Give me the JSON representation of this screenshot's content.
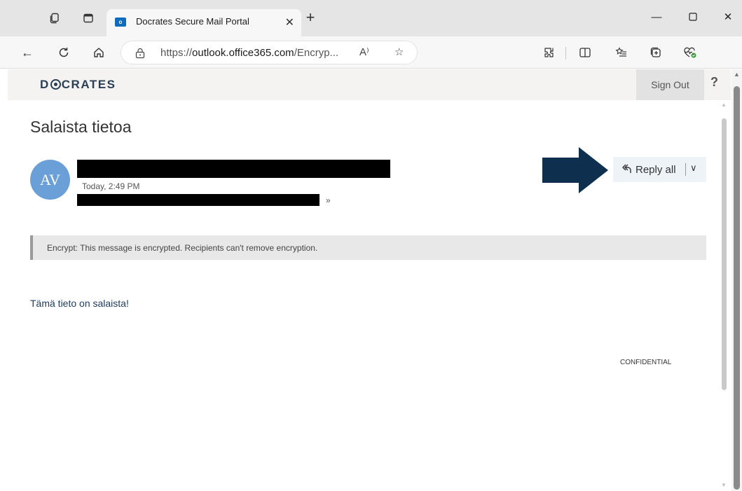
{
  "browser": {
    "tab_title": "Docrates Secure Mail Portal",
    "url_prefix": "https://",
    "url_host": "outlook.office365.com",
    "url_rest": "/Encryp...",
    "read_aloud_label": "A⁾",
    "accent_color": "#0f6cbd"
  },
  "page": {
    "logo_left": "D",
    "logo_right": "CRATES",
    "sign_out_label": "Sign Out",
    "help_label": "?"
  },
  "message": {
    "subject": "Salaista tietoa",
    "avatar_initials": "AV",
    "avatar_color": "#6a9fd8",
    "datetime": "Today, 2:49 PM",
    "reply_all_label": "Reply all",
    "encryption_notice": "Encrypt: This message is encrypted. Recipients can't remove encryption.",
    "body": "Tämä tieto on salaista!",
    "classification": "CONFIDENTIAL"
  },
  "icons": {
    "tab_actions": "tab-actions-icon",
    "vertical_tabs": "vertical-tabs-icon",
    "outlook": "outlook-favicon",
    "close_tab": "close-icon",
    "new_tab": "plus-icon",
    "minimize": "minimize-icon",
    "maximize": "maximize-icon",
    "close_window": "close-window-icon",
    "back": "back-arrow-icon",
    "refresh": "refresh-icon",
    "home": "home-icon",
    "lock": "lock-icon",
    "favorite": "star-icon",
    "extensions": "extensions-icon",
    "split_screen": "split-screen-icon",
    "favorites": "favorites-icon",
    "collections": "collections-icon",
    "browser_essentials": "heart-pulse-icon",
    "reply_all": "reply-all-icon",
    "dropdown": "chevron-down-icon",
    "expand": "double-chevron-down-icon",
    "annotation_arrow": "arrow-right-icon"
  }
}
